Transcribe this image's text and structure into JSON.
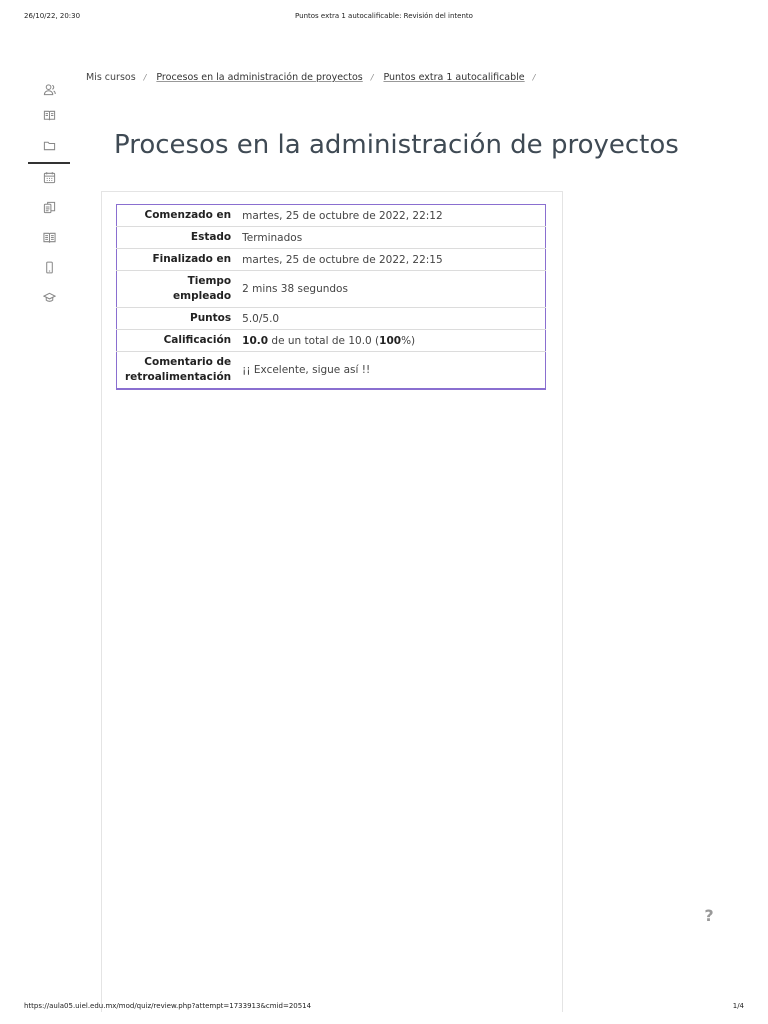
{
  "print_header": {
    "datetime": "26/10/22, 20:30",
    "page_title": "Puntos extra 1 autocalificable: Revisión del intento"
  },
  "print_footer": {
    "url": "https://aula05.uiel.edu.mx/mod/quiz/review.php?attempt=1733913&cmid=20514",
    "page_counter": "1/4"
  },
  "sidebar": {
    "items": [
      {
        "icon": "users-icon"
      },
      {
        "icon": "book-icon"
      },
      {
        "icon": "folder-icon",
        "active": true
      },
      {
        "icon": "calendar-icon"
      },
      {
        "icon": "copy-icon"
      },
      {
        "icon": "book-open-icon"
      },
      {
        "icon": "phone-icon"
      },
      {
        "icon": "graduation-cap-icon"
      }
    ]
  },
  "breadcrumb": {
    "home": "Mis cursos",
    "course": "Procesos en la administración de proyectos",
    "activity": "Puntos extra 1 autocalificable",
    "separator": "/"
  },
  "page_title": "Procesos en la administración de proyectos",
  "summary": {
    "started_label": "Comenzado en",
    "started_value": "martes, 25 de octubre de 2022, 22:12",
    "state_label": "Estado",
    "state_value": "Terminados",
    "finished_label": "Finalizado en",
    "finished_value": "martes, 25 de octubre de 2022, 22:15",
    "time_label_line1": "Tiempo",
    "time_label_line2": "empleado",
    "time_value": "2 mins 38 segundos",
    "points_label": "Puntos",
    "points_value": "5.0/5.0",
    "grade_label": "Calificación",
    "grade_score": "10.0",
    "grade_middle": " de un total de 10.0 (",
    "grade_percent": "100",
    "grade_end": "%)",
    "feedback_label_line1": "Comentario de",
    "feedback_label_line2": "retroalimentación",
    "feedback_value": "¡¡ Excelente, sigue así !!"
  },
  "help": {
    "label": "?"
  }
}
